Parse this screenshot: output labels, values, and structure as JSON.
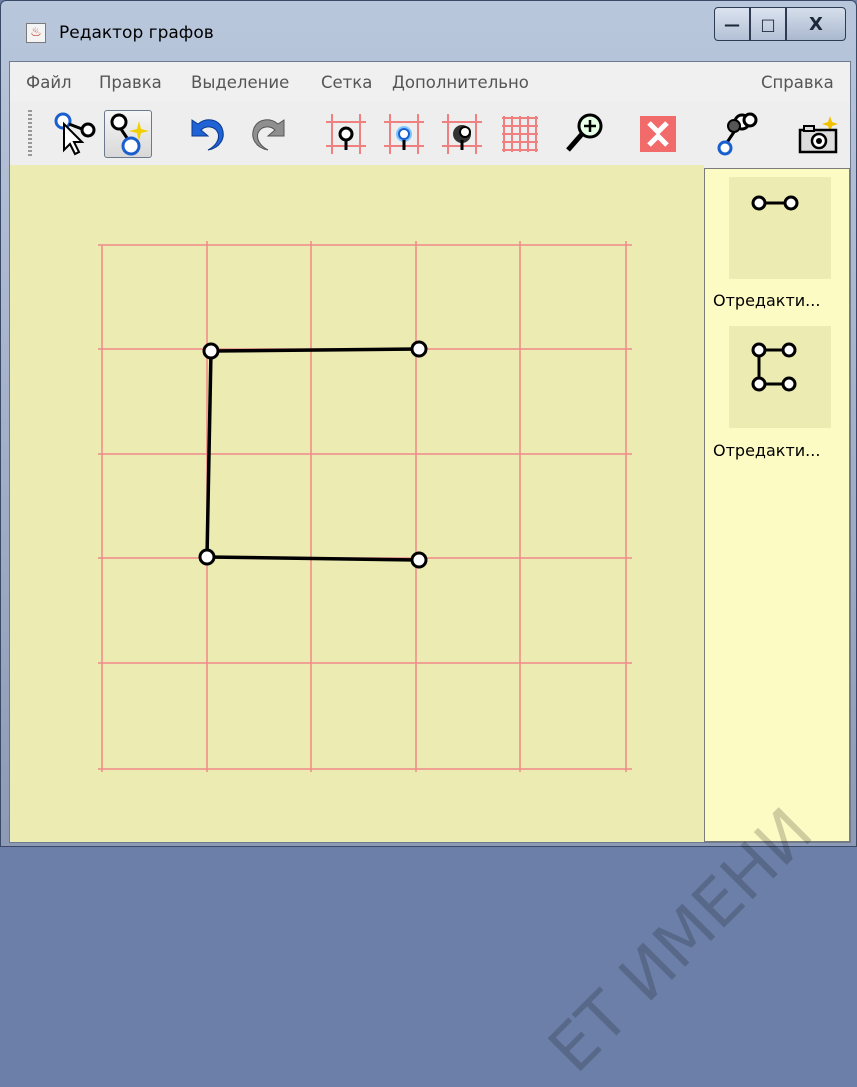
{
  "window": {
    "title": "Редактор графов",
    "controls": {
      "minimize": "—",
      "maximize": "□",
      "close": "X"
    }
  },
  "menu": {
    "items": [
      "Файл",
      "Правка",
      "Выделение",
      "Сетка",
      "Дополнительно"
    ],
    "help": "Справка"
  },
  "toolbar": {
    "tools": [
      {
        "name": "select-tool",
        "active": false
      },
      {
        "name": "add-vertex-tool",
        "active": true
      },
      {
        "name": "undo-tool",
        "active": false
      },
      {
        "name": "redo-tool",
        "active": false
      },
      {
        "name": "snap-grid-tool",
        "active": false
      },
      {
        "name": "snap-grid-blue-tool",
        "active": false
      },
      {
        "name": "snap-grid-shadow-tool",
        "active": false
      },
      {
        "name": "grid-toggle-tool",
        "active": false
      },
      {
        "name": "zoom-tool",
        "active": false
      },
      {
        "name": "delete-tool",
        "active": false
      },
      {
        "name": "graph-tool",
        "active": false
      },
      {
        "name": "snapshot-tool",
        "active": false
      }
    ]
  },
  "graph": {
    "vertices": [
      {
        "id": "v1"
      },
      {
        "id": "v2"
      },
      {
        "id": "v3"
      },
      {
        "id": "v4"
      }
    ],
    "edges": [
      [
        "v1",
        "v2"
      ],
      [
        "v1",
        "v3"
      ],
      [
        "v3",
        "v4"
      ]
    ]
  },
  "sidepanel": {
    "items": [
      {
        "label": "Отредакти...",
        "icon": "two-vertex-edge-icon"
      },
      {
        "label": "Отредакти...",
        "icon": "four-vertex-graph-icon"
      }
    ]
  },
  "watermark": "ЕТ ИМЕНИ",
  "colors": {
    "canvas": "#ecebb2",
    "grid": "#f08a8a",
    "panel": "#fdfbc4"
  }
}
